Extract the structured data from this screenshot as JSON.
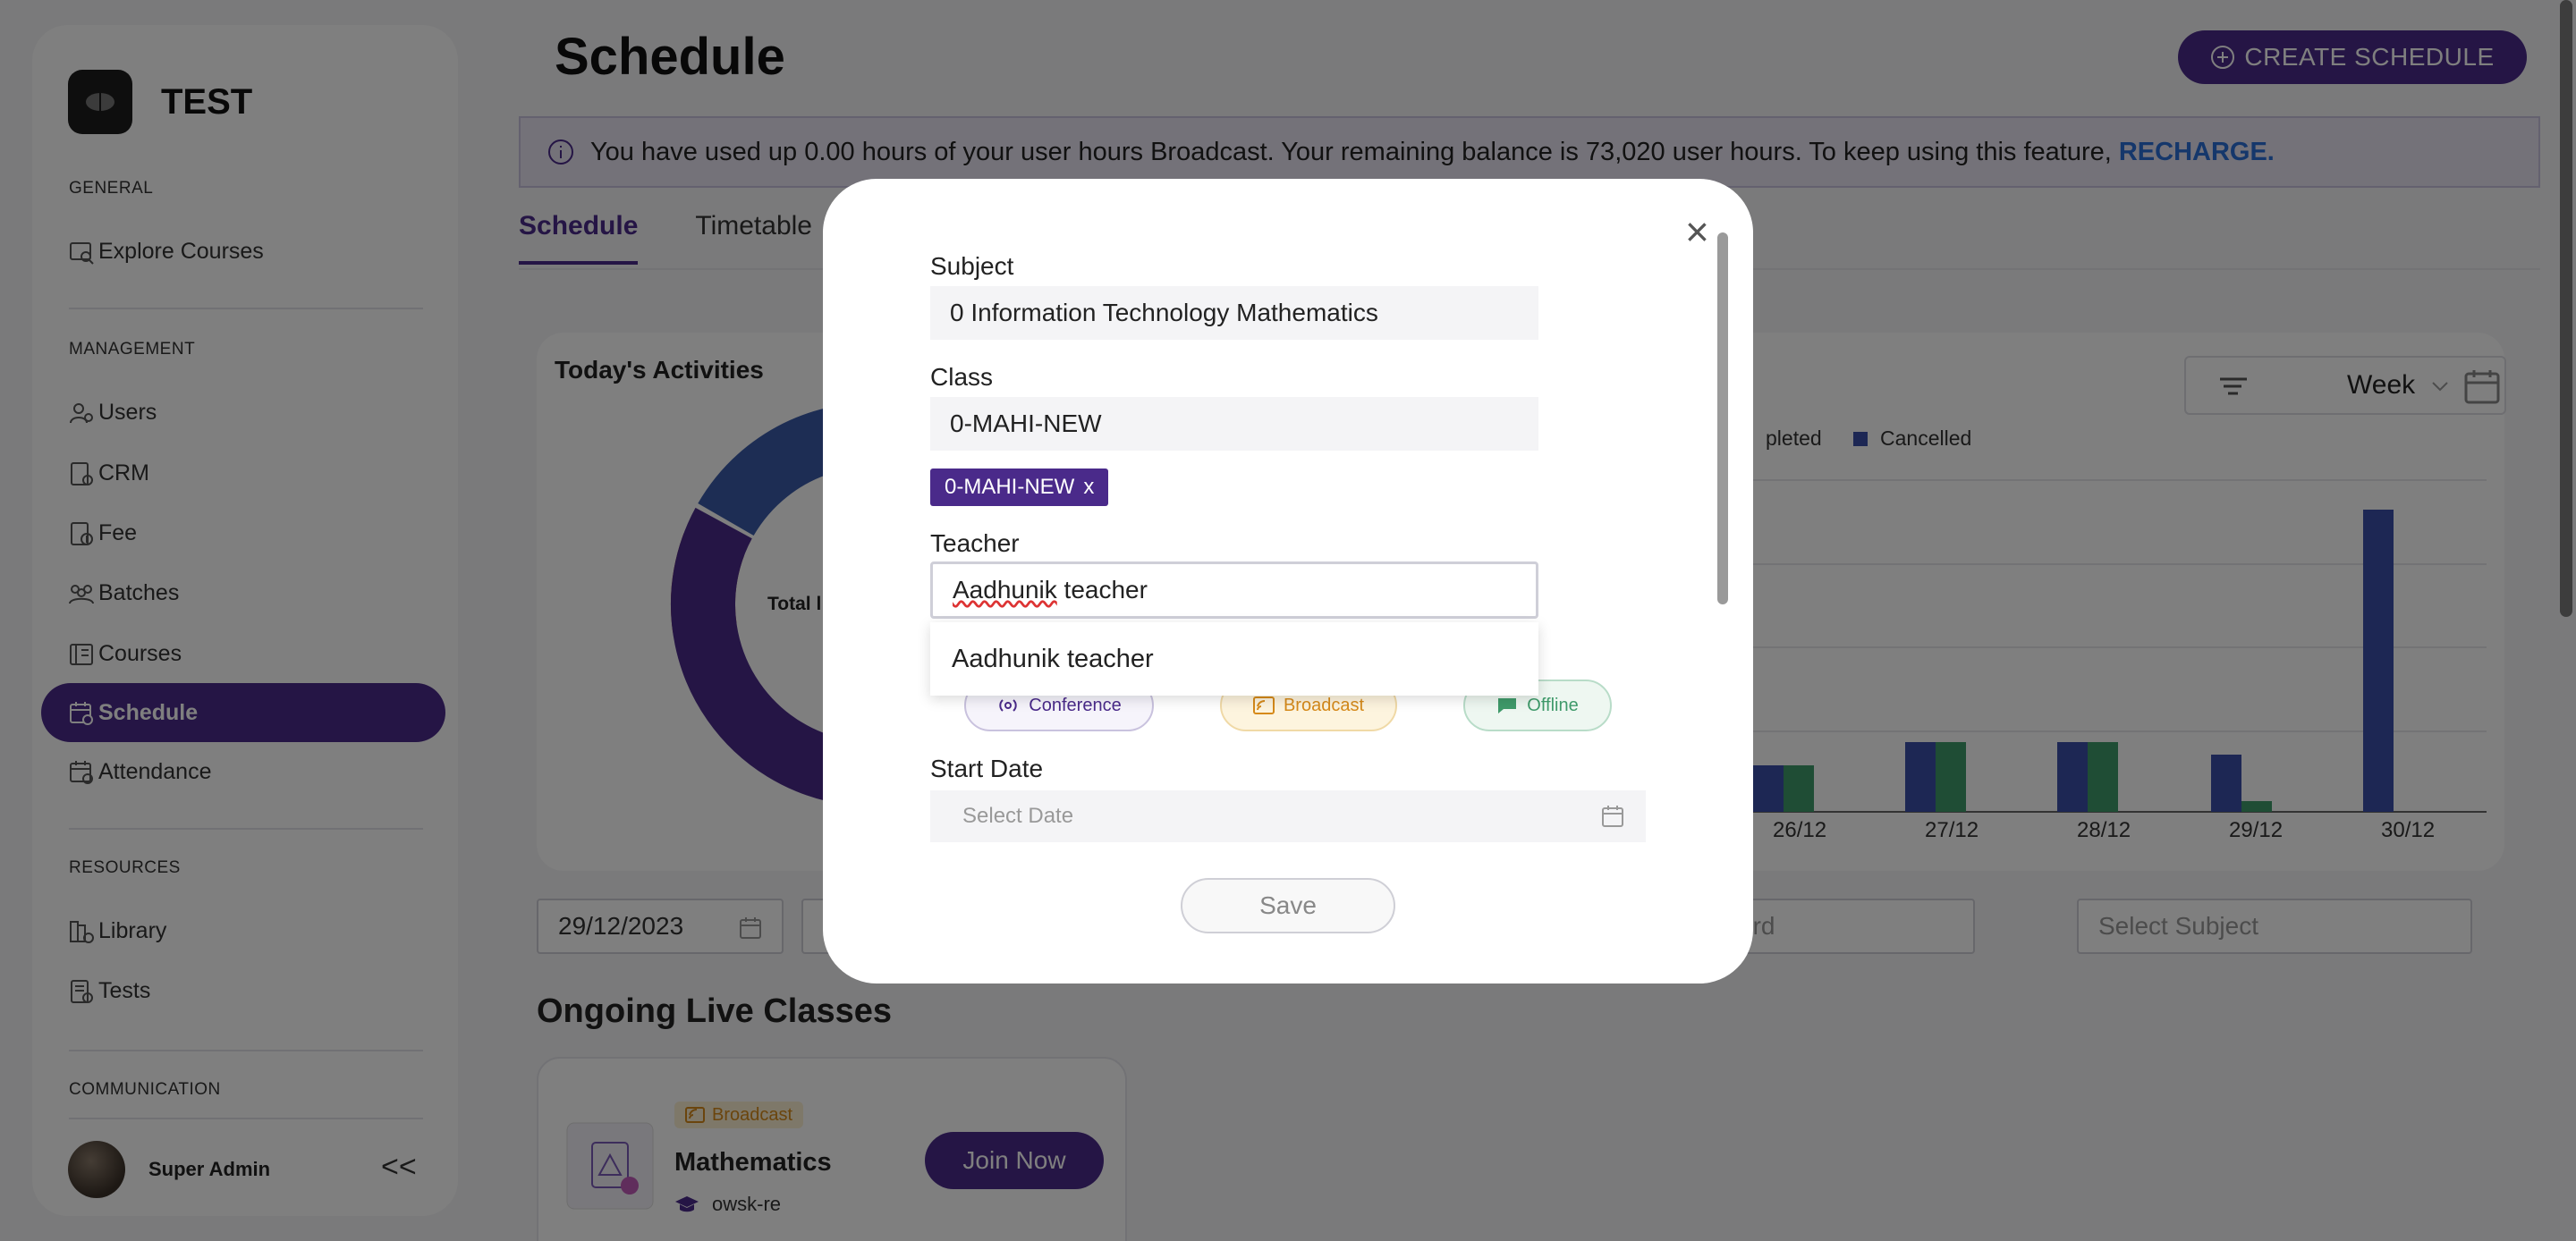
{
  "brand": {
    "name": "TEST"
  },
  "sidebar": {
    "general_label": "GENERAL",
    "management_label": "MANAGEMENT",
    "resources_label": "RESOURCES",
    "communication_label": "COMMUNICATION",
    "items": [
      {
        "label": "Explore Courses",
        "icon": "explore-courses-icon"
      },
      {
        "label": "Users",
        "icon": "users-icon"
      },
      {
        "label": "CRM",
        "icon": "crm-icon"
      },
      {
        "label": "Fee",
        "icon": "fee-icon"
      },
      {
        "label": "Batches",
        "icon": "batches-icon"
      },
      {
        "label": "Courses",
        "icon": "courses-icon"
      },
      {
        "label": "Schedule",
        "icon": "schedule-icon",
        "active": true
      },
      {
        "label": "Attendance",
        "icon": "attendance-icon"
      },
      {
        "label": "Library",
        "icon": "library-icon"
      },
      {
        "label": "Tests",
        "icon": "tests-icon"
      }
    ],
    "user_name": "Super Admin",
    "collapse_label": "<<"
  },
  "header": {
    "title": "Schedule",
    "create_button": "CREATE SCHEDULE"
  },
  "banner": {
    "text": "You have used up 0.00 hours of your user hours Broadcast. Your remaining balance is 73,020 user hours. To keep using this feature,",
    "link": "RECHARGE."
  },
  "tabs": [
    {
      "label": "Schedule",
      "active": true
    },
    {
      "label": "Timetable"
    }
  ],
  "activities": {
    "title": "Today's Activities",
    "donut_label": "Total l",
    "week_label": "Week",
    "legend": [
      {
        "label": "pleted",
        "color": "#3f9a6a"
      },
      {
        "label": "Cancelled",
        "color": "#3b4fa8"
      }
    ],
    "x_labels": [
      "26/12",
      "27/12",
      "28/12",
      "29/12",
      "30/12"
    ]
  },
  "filters": {
    "date_value": "29/12/2023",
    "board_placeholder": "ard",
    "subject_placeholder": "Select Subject"
  },
  "live": {
    "title": "Ongoing Live Classes",
    "badge": "Broadcast",
    "subject": "Mathematics",
    "teacher": "owsk-re",
    "join_button": "Join Now"
  },
  "modal": {
    "subject_label": "Subject",
    "subject_value": "0 Information Technology Mathematics",
    "class_label": "Class",
    "class_value": "0-MAHI-NEW",
    "class_chip": "0-MAHI-NEW",
    "chip_remove": "x",
    "teacher_label": "Teacher",
    "teacher_value_part1": "Aadhunik",
    "teacher_value_part2": " teacher",
    "dropdown_option": "Aadhunik teacher",
    "modes": [
      {
        "label": "Conference",
        "color": "#4a2a8a"
      },
      {
        "label": "Broadcast",
        "color": "#d68a1a"
      },
      {
        "label": "Offline",
        "color": "#3f9a6a"
      }
    ],
    "start_date_label": "Start Date",
    "start_date_placeholder": "Select Date",
    "save_button": "Save",
    "close_label": "×"
  }
}
